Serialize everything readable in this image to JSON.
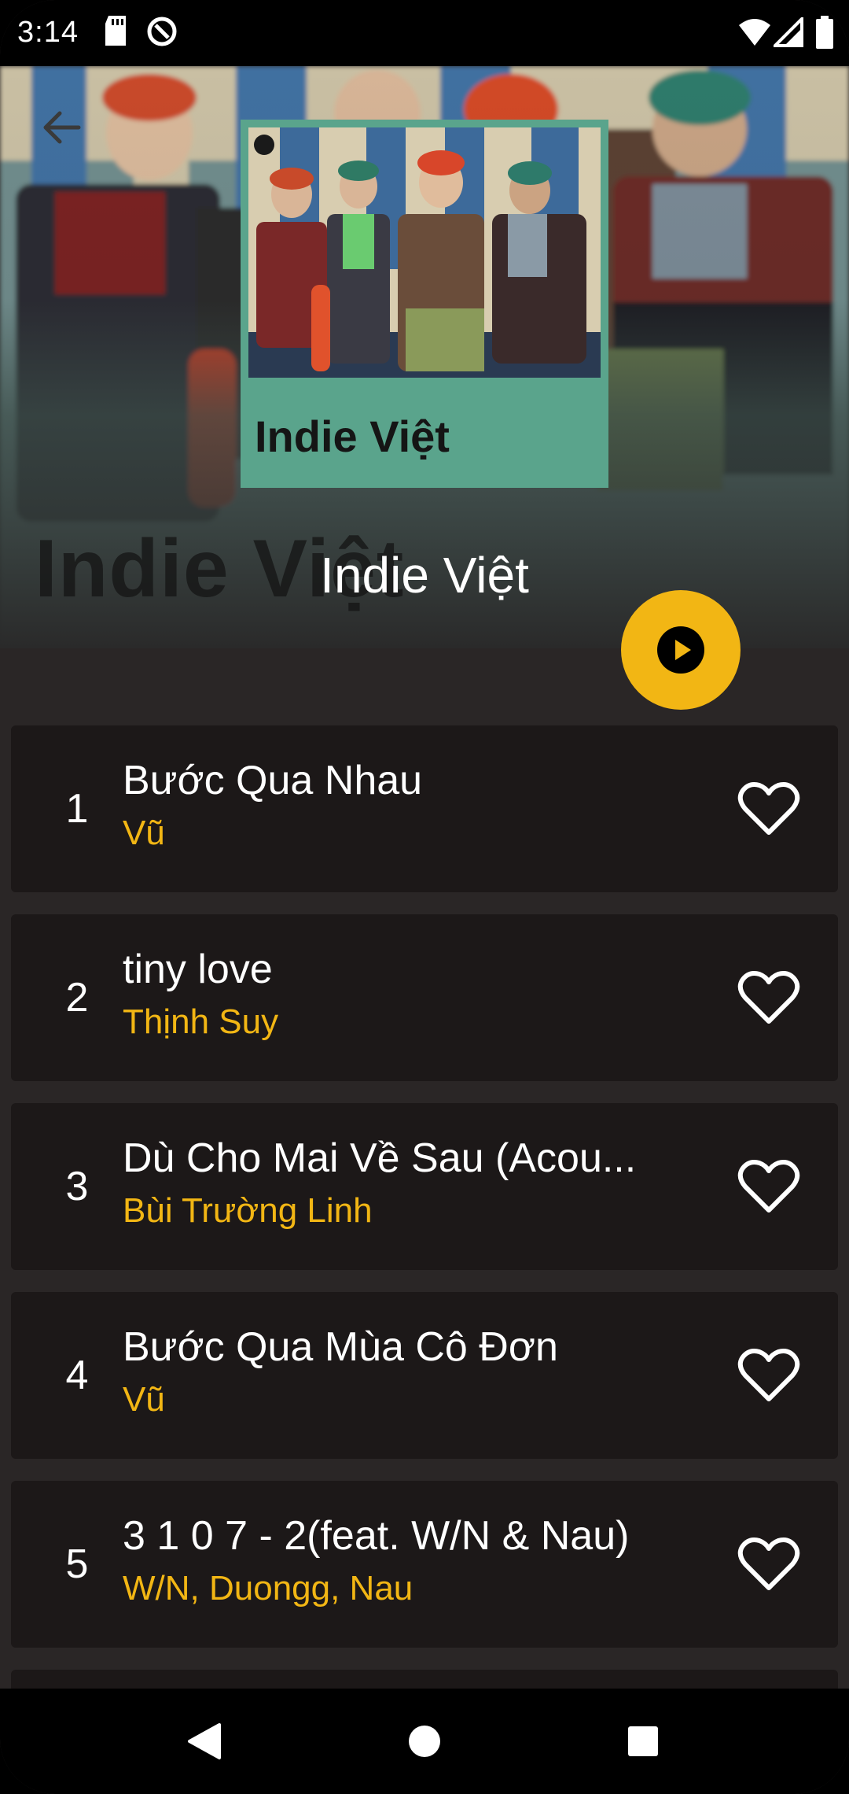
{
  "status_bar": {
    "time": "3:14",
    "icons": [
      "sd-card-icon",
      "data-saver-icon",
      "wifi-icon",
      "signal-icon",
      "battery-icon"
    ]
  },
  "header": {
    "back_icon": "arrow-left-icon",
    "cover_brand_icon": "spotify-icon",
    "cover_title": "Indie Việt",
    "background_title": "Indie Việt",
    "playlist_title": "Indie Việt"
  },
  "play_button": {
    "icon": "play-circle-icon",
    "color": "#f2b614"
  },
  "tracks": [
    {
      "number": "1",
      "title": "Bước Qua Nhau",
      "artist": "Vũ"
    },
    {
      "number": "2",
      "title": "tiny love",
      "artist": "Thịnh Suy"
    },
    {
      "number": "3",
      "title": "Dù Cho Mai Về Sau (Acou...",
      "artist": "Bùi Trường Linh"
    },
    {
      "number": "4",
      "title": "Bước Qua Mùa Cô Đơn",
      "artist": "Vũ"
    },
    {
      "number": "5",
      "title": "3 1 0 7 - 2(feat. W/N & Nau)",
      "artist": "W/N, Duongg, Nau"
    }
  ],
  "colors": {
    "accent": "#f2b614",
    "card_background": "#1c1818",
    "page_background": "#2a2626",
    "cover_background": "#5aa48c"
  },
  "nav_bar": {
    "back_icon": "nav-back-triangle-icon",
    "home_icon": "nav-home-circle-icon",
    "recents_icon": "nav-recents-square-icon"
  }
}
